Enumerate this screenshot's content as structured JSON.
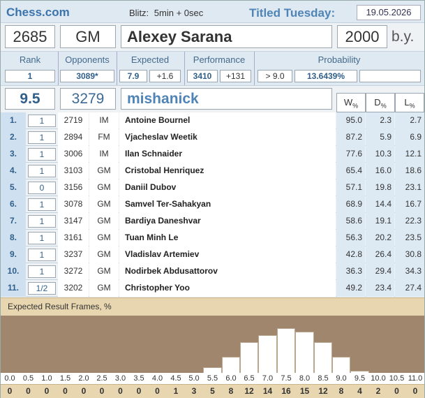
{
  "header": {
    "site": "Chess.com",
    "mode_label": "Blitz:",
    "mode_value": "5min + 0sec",
    "event": "Titled Tuesday:",
    "date": "19.05.2026"
  },
  "player": {
    "rating": "2685",
    "title": "GM",
    "name": "Alexey Sarana",
    "birth_year": "2000",
    "birth_suffix": "b.y."
  },
  "stats": {
    "rank_label": "Rank",
    "rank": "1",
    "opponents_label": "Opponents",
    "opponents_avg": "3089*",
    "expected_label": "Expected",
    "expected": "7.9",
    "expected_diff": "+1.6",
    "performance_label": "Performance",
    "performance": "3410",
    "performance_diff": "+131",
    "probability_label": "Probability",
    "probability_threshold": "> 9.0",
    "probability_value": "13.6439%",
    "probability_extra": ""
  },
  "summary": {
    "score": "9.5",
    "opp_rating": "3279",
    "username": "mishanick"
  },
  "columns": {
    "w": "W",
    "d": "D",
    "l": "L",
    "pct": "%"
  },
  "games": [
    {
      "no": "1.",
      "result": "1",
      "rating": "2719",
      "title": "IM",
      "name": "Antoine Bournel",
      "w": "95.0",
      "d": "2.3",
      "l": "2.7"
    },
    {
      "no": "2.",
      "result": "1",
      "rating": "2894",
      "title": "FM",
      "name": "Vjacheslav Weetik",
      "w": "87.2",
      "d": "5.9",
      "l": "6.9"
    },
    {
      "no": "3.",
      "result": "1",
      "rating": "3006",
      "title": "IM",
      "name": "Ilan Schnaider",
      "w": "77.6",
      "d": "10.3",
      "l": "12.1"
    },
    {
      "no": "4.",
      "result": "1",
      "rating": "3103",
      "title": "GM",
      "name": "Cristobal Henriquez",
      "w": "65.4",
      "d": "16.0",
      "l": "18.6"
    },
    {
      "no": "5.",
      "result": "0",
      "rating": "3156",
      "title": "GM",
      "name": "Daniil Dubov",
      "w": "57.1",
      "d": "19.8",
      "l": "23.1"
    },
    {
      "no": "6.",
      "result": "1",
      "rating": "3078",
      "title": "GM",
      "name": "Samvel Ter-Sahakyan",
      "w": "68.9",
      "d": "14.4",
      "l": "16.7"
    },
    {
      "no": "7.",
      "result": "1",
      "rating": "3147",
      "title": "GM",
      "name": "Bardiya Daneshvar",
      "w": "58.6",
      "d": "19.1",
      "l": "22.3"
    },
    {
      "no": "8.",
      "result": "1",
      "rating": "3161",
      "title": "GM",
      "name": "Tuan Minh Le",
      "w": "56.3",
      "d": "20.2",
      "l": "23.5"
    },
    {
      "no": "9.",
      "result": "1",
      "rating": "3237",
      "title": "GM",
      "name": "Vladislav Artemiev",
      "w": "42.8",
      "d": "26.4",
      "l": "30.8"
    },
    {
      "no": "10.",
      "result": "1",
      "rating": "3272",
      "title": "GM",
      "name": "Nodirbek Abdusattorov",
      "w": "36.3",
      "d": "29.4",
      "l": "34.3"
    },
    {
      "no": "11.",
      "result": "1/2",
      "rating": "3202",
      "title": "GM",
      "name": "Christopher Yoo",
      "w": "49.2",
      "d": "23.4",
      "l": "27.4"
    }
  ],
  "frames": {
    "title": "Expected Result Frames, %"
  },
  "chart_data": {
    "type": "bar",
    "title": "Expected Result Frames, %",
    "categories": [
      "0.0",
      "0.5",
      "1.0",
      "1.5",
      "2.0",
      "2.5",
      "3.0",
      "3.5",
      "4.0",
      "4.5",
      "5.0",
      "5.5",
      "6.0",
      "6.5",
      "7.0",
      "7.5",
      "8.0",
      "8.5",
      "9.0",
      "9.5",
      "10.0",
      "10.5",
      "11.0"
    ],
    "values": [
      0,
      0,
      0,
      0,
      0,
      0,
      0,
      0,
      0,
      1,
      3,
      5,
      8,
      12,
      14,
      16,
      15,
      12,
      8,
      4,
      2,
      0,
      0
    ],
    "labels": [
      "0",
      "0",
      "0",
      "0",
      "0",
      "0",
      "0",
      "0",
      "0",
      "1",
      "3",
      "5",
      "8",
      "12",
      "14",
      "16",
      "15",
      "12",
      "8",
      "4",
      "2",
      "0",
      "0"
    ]
  }
}
